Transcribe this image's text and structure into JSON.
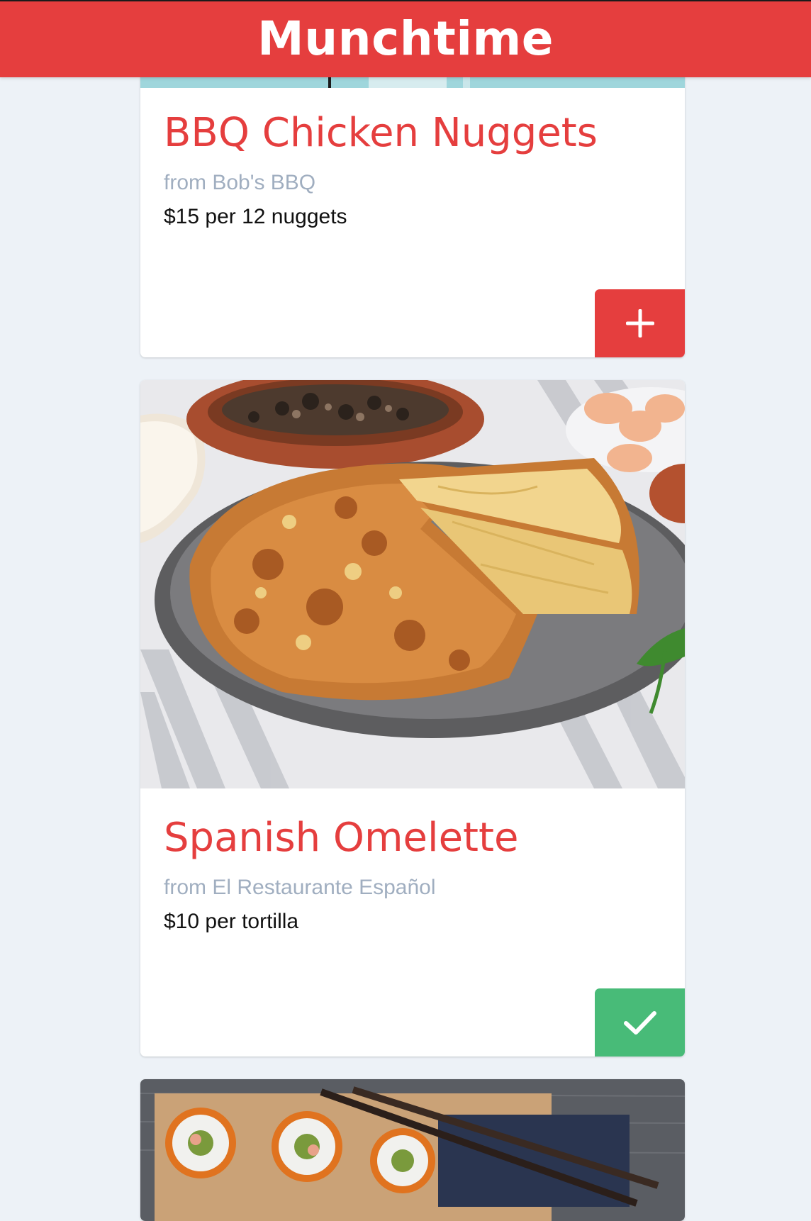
{
  "header": {
    "title": "Munchtime"
  },
  "colors": {
    "brand": "#e53e3e",
    "success": "#48bb78",
    "page_background": "#edf2f7",
    "muted_text": "#a0aec0"
  },
  "feed": {
    "items": [
      {
        "name": "BBQ Chicken Nuggets",
        "restaurant": "from Bob's BBQ",
        "price": "$15 per 12 nuggets",
        "action": "add",
        "action_icon": "plus-icon",
        "image_alt": "BBQ chicken nuggets photo"
      },
      {
        "name": "Spanish Omelette",
        "restaurant": "from El Restaurante Español",
        "price": "$10 per tortilla",
        "action": "added",
        "action_icon": "check-icon",
        "image_alt": "Spanish omelette photo"
      },
      {
        "image_alt": "Sushi rolls photo"
      }
    ]
  }
}
